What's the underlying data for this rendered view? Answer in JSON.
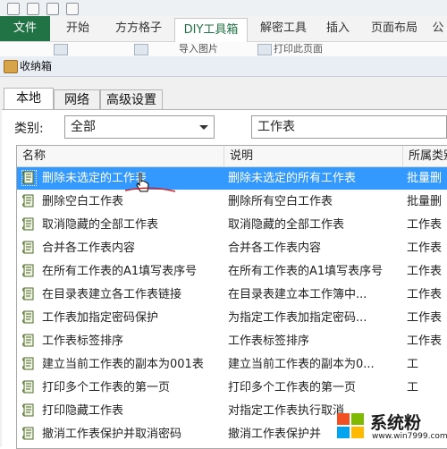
{
  "ribbon": {
    "tabs": [
      {
        "label": "文件",
        "active": false
      },
      {
        "label": "开始",
        "active": false
      },
      {
        "label": "方方格子",
        "active": false
      },
      {
        "label": "DIY工具箱",
        "active": true
      },
      {
        "label": "解密工具",
        "active": false
      },
      {
        "label": "插入",
        "active": false
      },
      {
        "label": "页面布局",
        "active": false
      },
      {
        "label": "公",
        "active": false
      }
    ],
    "fragments": [
      "导入图片",
      "打印此页面"
    ]
  },
  "dialog": {
    "title": "收纳箱",
    "tabs": [
      "本地",
      "网络",
      "高级设置"
    ],
    "active_tab": "本地",
    "category_label": "类别:",
    "category_value": "全部",
    "search_value": "工作表",
    "columns": [
      "名称",
      "说明",
      "所属类别"
    ],
    "rows": [
      {
        "name": "删除未选定的工作表",
        "desc": "删除未选定的所有工作表",
        "cat": "批量删",
        "selected": true
      },
      {
        "name": "删除空白工作表",
        "desc": "删除所有空白工作表",
        "cat": "批量删",
        "selected": false
      },
      {
        "name": "取消隐藏的全部工作表",
        "desc": "取消隐藏的全部工作表",
        "cat": "工作表",
        "selected": false
      },
      {
        "name": "合并各工作表内容",
        "desc": "合并各工作表内容",
        "cat": "工作表",
        "selected": false
      },
      {
        "name": "在所有工作表的A1填写表序号",
        "desc": "在所有工作表的A1填写表序号",
        "cat": "工作表",
        "selected": false
      },
      {
        "name": "在目录表建立各工作表链接",
        "desc": "在目录表建立本工作簿中...",
        "cat": "工作表",
        "selected": false
      },
      {
        "name": "工作表加指定密码保护",
        "desc": "为指定工作表加指定密码...",
        "cat": "工作表",
        "selected": false
      },
      {
        "name": "工作表标签排序",
        "desc": "工作表标签排序",
        "cat": "工作表",
        "selected": false
      },
      {
        "name": "建立当前工作表的副本为001表",
        "desc": "建立当前工作表的副本为0...",
        "cat": "工",
        "selected": false
      },
      {
        "name": "打印多个工作表的第一页",
        "desc": "打印多个工作表的第一页",
        "cat": "工",
        "selected": false
      },
      {
        "name": "打印隐藏工作表",
        "desc": "对指定工作表执行取消",
        "cat": "",
        "selected": false
      },
      {
        "name": "撤消工作表保护并取消密码",
        "desc": "撤消工作表保护并",
        "cat": "",
        "selected": false
      }
    ]
  },
  "watermark": {
    "text": "系统粉",
    "url": "www.win7999.com"
  },
  "colors": {
    "file_tab": "#217346",
    "selection": "#3399ff",
    "active_tab_text": "#217346"
  },
  "icons": {
    "row": "script-book-icon",
    "title": "box-icon",
    "cursor": "hand-cursor-icon"
  }
}
